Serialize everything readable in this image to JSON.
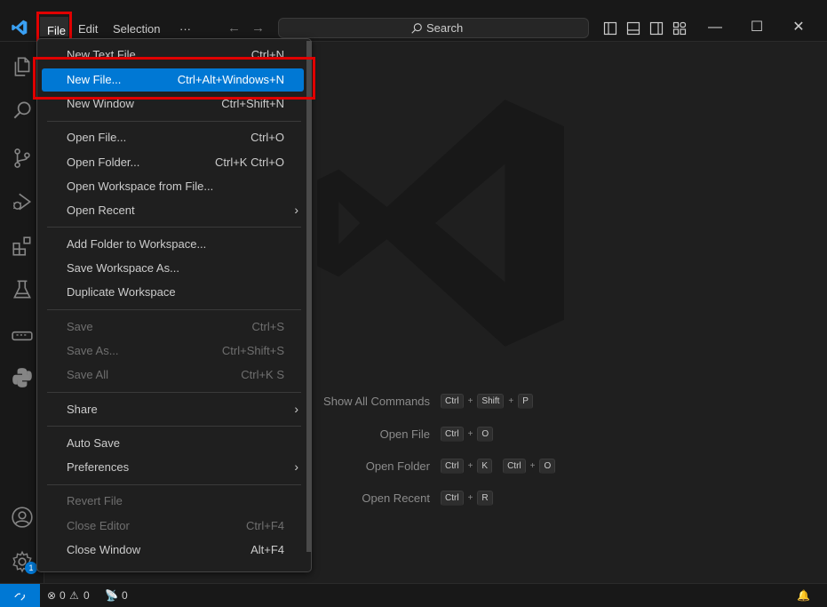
{
  "titlebar": {
    "menu": [
      "File",
      "Edit",
      "Selection",
      "···"
    ],
    "search_placeholder": "Search",
    "search_icon": "search-icon"
  },
  "file_menu": {
    "items": [
      {
        "label": "New Text File",
        "shortcut": "Ctrl+N",
        "enabled": true
      },
      {
        "label": "New File...",
        "shortcut": "Ctrl+Alt+Windows+N",
        "enabled": true,
        "selected": true
      },
      {
        "label": "New Window",
        "shortcut": "Ctrl+Shift+N",
        "enabled": true
      },
      {
        "label": "Open File...",
        "shortcut": "Ctrl+O",
        "enabled": true
      },
      {
        "label": "Open Folder...",
        "shortcut": "Ctrl+K Ctrl+O",
        "enabled": true
      },
      {
        "label": "Open Workspace from File...",
        "shortcut": "",
        "enabled": true
      },
      {
        "label": "Open Recent",
        "shortcut": "",
        "enabled": true,
        "submenu": true
      },
      {
        "label": "Add Folder to Workspace...",
        "shortcut": "",
        "enabled": true
      },
      {
        "label": "Save Workspace As...",
        "shortcut": "",
        "enabled": true
      },
      {
        "label": "Duplicate Workspace",
        "shortcut": "",
        "enabled": true
      },
      {
        "label": "Save",
        "shortcut": "Ctrl+S",
        "enabled": false
      },
      {
        "label": "Save As...",
        "shortcut": "Ctrl+Shift+S",
        "enabled": false
      },
      {
        "label": "Save All",
        "shortcut": "Ctrl+K S",
        "enabled": false
      },
      {
        "label": "Share",
        "shortcut": "",
        "enabled": true,
        "submenu": true
      },
      {
        "label": "Auto Save",
        "shortcut": "",
        "enabled": true
      },
      {
        "label": "Preferences",
        "shortcut": "",
        "enabled": true,
        "submenu": true
      },
      {
        "label": "Revert File",
        "shortcut": "",
        "enabled": false
      },
      {
        "label": "Close Editor",
        "shortcut": "Ctrl+F4",
        "enabled": false
      },
      {
        "label": "Close Window",
        "shortcut": "Alt+F4",
        "enabled": true
      }
    ]
  },
  "watermark_commands": [
    {
      "label": "Show All Commands",
      "keys": [
        [
          "Ctrl",
          "Shift",
          "P"
        ]
      ]
    },
    {
      "label": "Open File",
      "keys": [
        [
          "Ctrl",
          "O"
        ]
      ]
    },
    {
      "label": "Open Folder",
      "keys": [
        [
          "Ctrl",
          "K"
        ],
        [
          "Ctrl",
          "O"
        ]
      ]
    },
    {
      "label": "Open Recent",
      "keys": [
        [
          "Ctrl",
          "R"
        ]
      ]
    }
  ],
  "activity_icons": [
    "explorer-icon",
    "search-icon",
    "source-control-icon",
    "run-debug-icon",
    "extensions-icon",
    "testing-icon",
    "remote-explorer-icon",
    "python-icon"
  ],
  "accounts_badge": "1",
  "statusbar": {
    "errors": "0",
    "warnings": "0",
    "ports": "0"
  },
  "colors": {
    "accent": "#0078d4",
    "highlight_frame": "#e00000",
    "background": "#1f1f1f"
  }
}
